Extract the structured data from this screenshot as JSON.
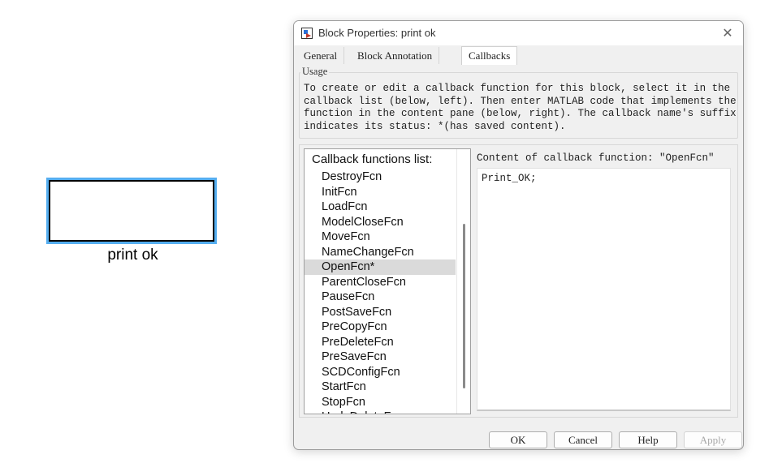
{
  "canvas": {
    "block_label": "print ok"
  },
  "dialog": {
    "title": "Block Properties: print ok",
    "close_glyph": "✕",
    "tabs": [
      {
        "label": "General",
        "active": false
      },
      {
        "label": "Block Annotation",
        "active": false
      },
      {
        "label": "Callbacks",
        "active": true
      }
    ],
    "usage": {
      "legend": "Usage",
      "text": "To create or edit a callback function for this block, select it in the\ncallback list (below, left). Then enter MATLAB code that implements the\nfunction in the content pane (below, right). The callback name's suffix\nindicates its status: *(has saved content)."
    },
    "callbacks": {
      "header": "Callback functions list:",
      "items": [
        "DestroyFcn",
        "InitFcn",
        "LoadFcn",
        "ModelCloseFcn",
        "MoveFcn",
        "NameChangeFcn",
        "OpenFcn*",
        "ParentCloseFcn",
        "PauseFcn",
        "PostSaveFcn",
        "PreCopyFcn",
        "PreDeleteFcn",
        "PreSaveFcn",
        "SCDConfigFcn",
        "StartFcn",
        "StopFcn",
        "UndoDeleteFcn"
      ],
      "selected": "OpenFcn*"
    },
    "content": {
      "label": "Content of callback function: \"OpenFcn\"",
      "code": "Print_OK;"
    },
    "buttons": {
      "ok": "OK",
      "cancel": "Cancel",
      "help": "Help",
      "apply": "Apply"
    }
  }
}
